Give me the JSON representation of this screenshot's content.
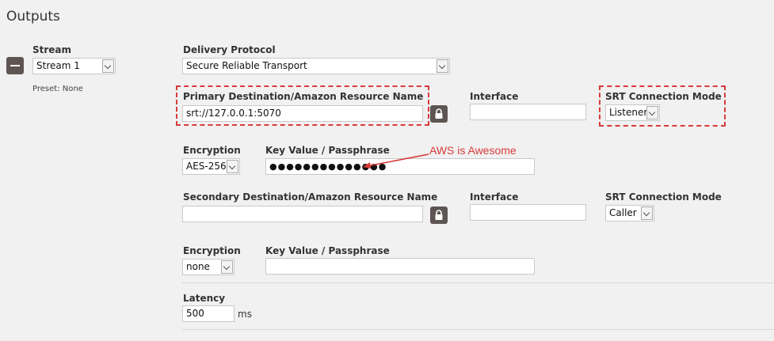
{
  "page": {
    "title": "Outputs"
  },
  "stream": {
    "label": "Stream",
    "value": "Stream 1",
    "preset": "Preset: None"
  },
  "delivery": {
    "label": "Delivery Protocol",
    "value": "Secure Reliable Transport"
  },
  "primary": {
    "dest_label": "Primary Destination/Amazon Resource Name",
    "dest_value": "srt://127.0.0.1:5070",
    "interface_label": "Interface",
    "interface_value": "",
    "mode_label": "SRT Connection Mode",
    "mode_value": "Listener",
    "encryption_label": "Encryption",
    "encryption_value": "AES-256",
    "key_label": "Key Value / Passphrase",
    "key_value": "●●●●●●●●●●●●●●"
  },
  "annotation": {
    "text": "AWS is Awesome",
    "color": "#d83a3a"
  },
  "secondary": {
    "dest_label": "Secondary Destination/Amazon Resource Name",
    "dest_value": "",
    "interface_label": "Interface",
    "interface_value": "",
    "mode_label": "SRT Connection Mode",
    "mode_value": "Caller",
    "encryption_label": "Encryption",
    "encryption_value": "none",
    "key_label": "Key Value / Passphrase",
    "key_value": ""
  },
  "latency": {
    "label": "Latency",
    "value": "500",
    "unit": "ms"
  },
  "icons": {
    "remove": "minus-icon",
    "lock": "lock-icon",
    "dropdown": "chevron-down-icon"
  }
}
